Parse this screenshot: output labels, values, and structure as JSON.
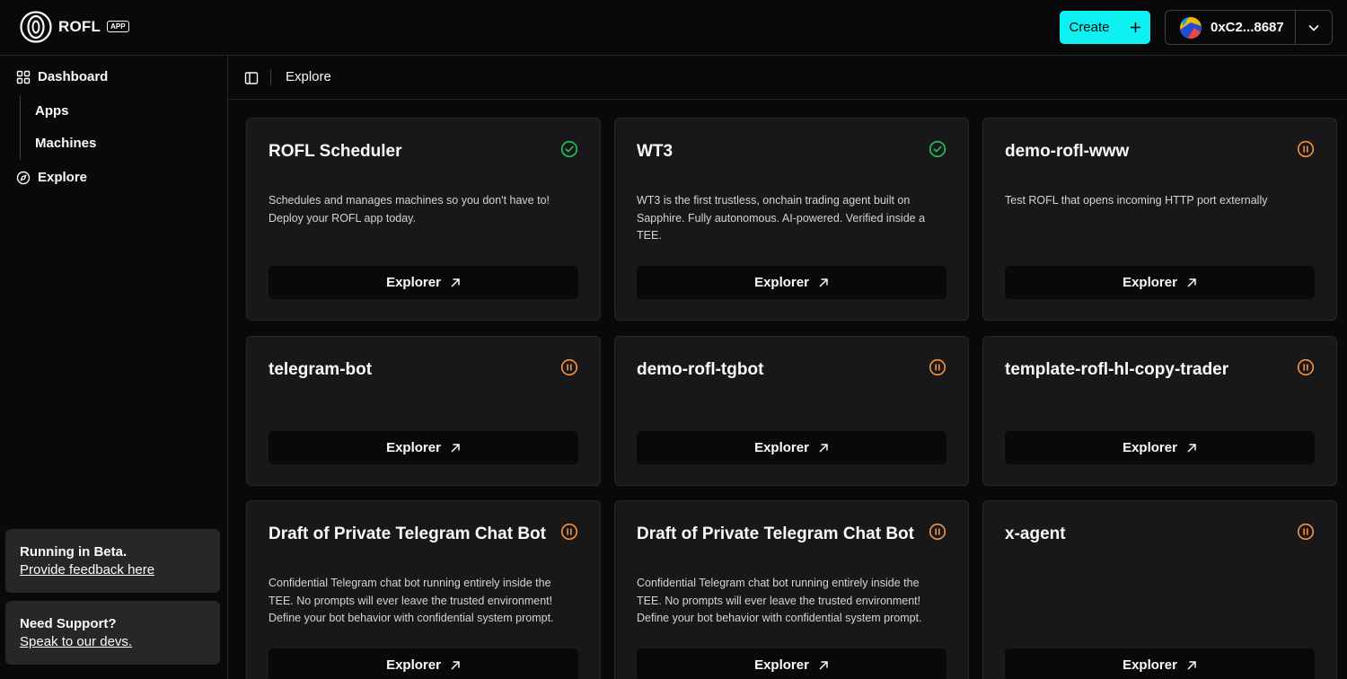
{
  "header": {
    "logo_text": "ROFL",
    "logo_badge": "APP",
    "create_label": "Create",
    "wallet_address": "0xC2...8687"
  },
  "sidebar": {
    "dashboard": "Dashboard",
    "apps": "Apps",
    "machines": "Machines",
    "explore": "Explore",
    "beta_title": "Running in Beta.",
    "beta_link": "Provide feedback here",
    "support_title": "Need Support?",
    "support_link": "Speak to our devs."
  },
  "breadcrumb": {
    "current": "Explore"
  },
  "colors": {
    "accent": "#0ff0f2",
    "status_active": "#22c55e",
    "status_paused": "#fb923c"
  },
  "cards": [
    {
      "title": "ROFL Scheduler",
      "status": "active",
      "status_icon": "check-circle-icon",
      "description": "Schedules and manages machines so you don't have to! Deploy your ROFL app today.",
      "button": "Explorer"
    },
    {
      "title": "WT3",
      "status": "active",
      "status_icon": "check-circle-icon",
      "description": "WT3 is the first trustless, onchain trading agent built on Sapphire. Fully autonomous. AI-powered. Verified inside a TEE.",
      "button": "Explorer"
    },
    {
      "title": "demo-rofl-www",
      "status": "paused",
      "status_icon": "pause-circle-icon",
      "description": "Test ROFL that opens incoming HTTP port externally",
      "button": "Explorer"
    },
    {
      "title": "telegram-bot",
      "status": "paused",
      "status_icon": "pause-circle-icon",
      "description": "",
      "button": "Explorer"
    },
    {
      "title": "demo-rofl-tgbot",
      "status": "paused",
      "status_icon": "pause-circle-icon",
      "description": "",
      "button": "Explorer"
    },
    {
      "title": "template-rofl-hl-copy-trader",
      "status": "paused",
      "status_icon": "pause-circle-icon",
      "description": "",
      "button": "Explorer"
    },
    {
      "title": "Draft of Private Telegram Chat Bot",
      "status": "paused",
      "status_icon": "pause-circle-icon",
      "description": "Confidential Telegram chat bot running entirely inside the TEE. No prompts will ever leave the trusted environment! Define your bot behavior with confidential system prompt.",
      "button": "Explorer"
    },
    {
      "title": "Draft of Private Telegram Chat Bot",
      "status": "paused",
      "status_icon": "pause-circle-icon",
      "description": "Confidential Telegram chat bot running entirely inside the TEE. No prompts will ever leave the trusted environment! Define your bot behavior with confidential system prompt.",
      "button": "Explorer"
    },
    {
      "title": "x-agent",
      "status": "paused",
      "status_icon": "pause-circle-icon",
      "description": "",
      "button": "Explorer"
    }
  ]
}
